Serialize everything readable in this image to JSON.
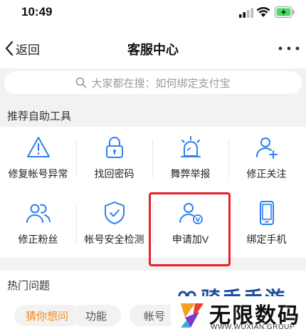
{
  "status": {
    "time": "10:49"
  },
  "nav": {
    "back_label": "返回",
    "title": "客服中心"
  },
  "search": {
    "placeholder": "大家都在搜：如何绑定支付宝"
  },
  "tools_section": {
    "title": "推荐自助工具",
    "items": [
      {
        "label": "修复帐号异常",
        "icon": "warning-icon"
      },
      {
        "label": "找回密码",
        "icon": "lock-icon"
      },
      {
        "label": "舞弊举报",
        "icon": "alarm-icon"
      },
      {
        "label": "修正关注",
        "icon": "user-add-icon"
      },
      {
        "label": "修正粉丝",
        "icon": "users-icon"
      },
      {
        "label": "帐号安全检测",
        "icon": "shield-icon"
      },
      {
        "label": "申请加V",
        "icon": "user-verified-icon"
      },
      {
        "label": "绑定手机",
        "icon": "phone-icon"
      }
    ]
  },
  "hot_section": {
    "title": "热门问题",
    "chips": [
      {
        "label": "猜你想问",
        "active": true
      },
      {
        "label": "功能",
        "active": false
      },
      {
        "label": "帐号",
        "active": false
      }
    ]
  },
  "watermark": {
    "top_text": "骑手手游",
    "title": "无限数码",
    "url": "WWW.WUXIAN.GROUP"
  },
  "colors": {
    "accent": "#2f7ff0",
    "highlight": "#e8202a",
    "active_chip": "#f08a1c",
    "watermark_blue": "#1f4d9c"
  }
}
